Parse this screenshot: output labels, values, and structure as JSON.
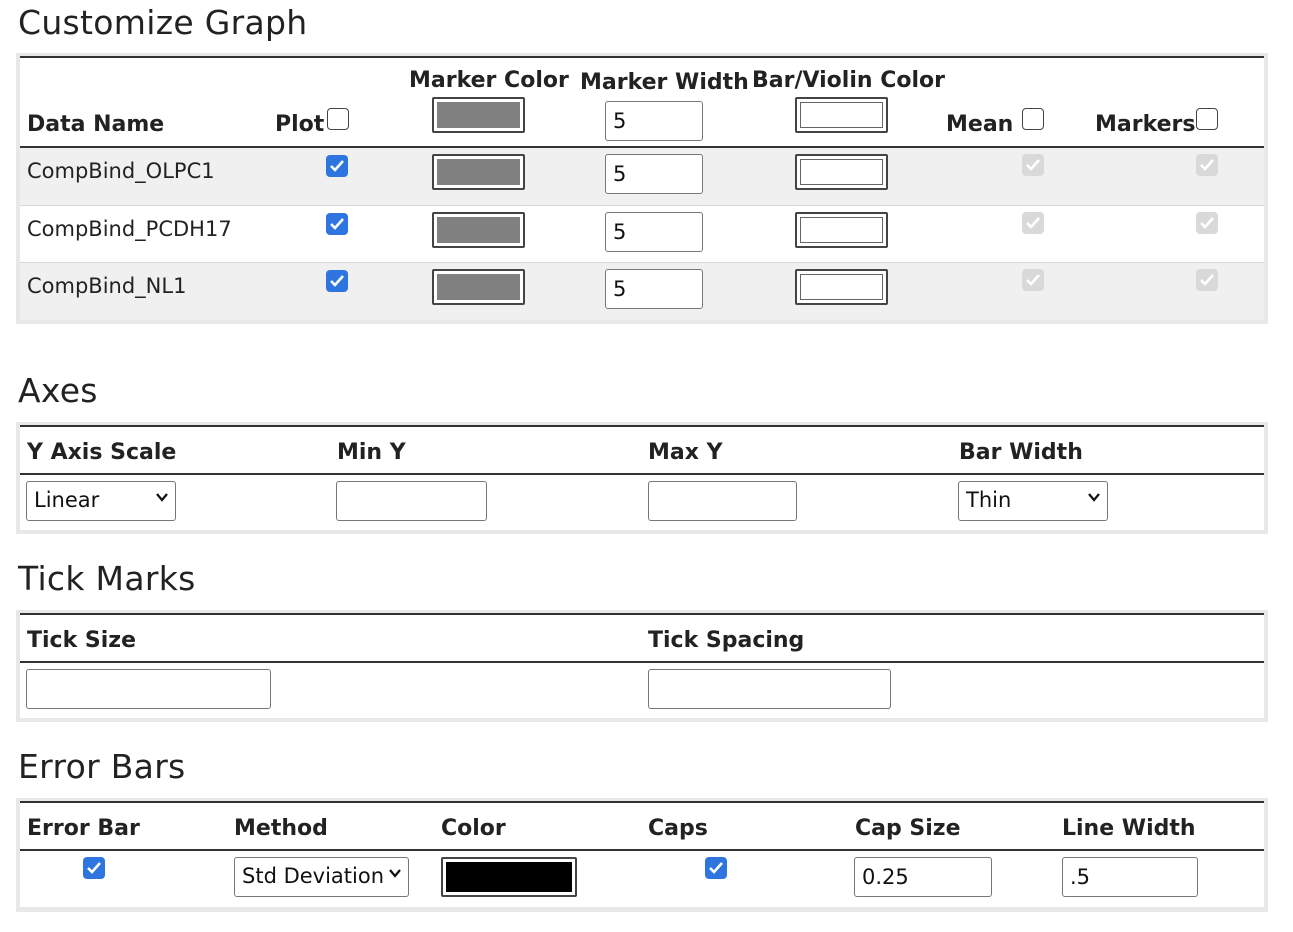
{
  "sections": {
    "customize_title": "Customize Graph",
    "axes_title": "Axes",
    "tick_title": "Tick Marks",
    "error_title": "Error Bars"
  },
  "customize": {
    "headers": {
      "data_name": "Data Name",
      "plot": "Plot",
      "marker_color": "Marker Color",
      "marker_width": "Marker Width",
      "bar_violin_color": "Bar/Violin Color",
      "mean": "Mean",
      "markers": "Markers"
    },
    "header_marker_width_value": "5",
    "rows": [
      {
        "name": "CompBind_OLPC1",
        "width": "5"
      },
      {
        "name": "CompBind_PCDH17",
        "width": "5"
      },
      {
        "name": "CompBind_NL1",
        "width": "5"
      }
    ],
    "marker_color": "#808080",
    "bar_color": "#ffffff"
  },
  "axes": {
    "headers": {
      "y_scale": "Y Axis Scale",
      "min_y": "Min Y",
      "max_y": "Max Y",
      "bar_width": "Bar Width"
    },
    "y_scale_value": "Linear",
    "min_y_value": "",
    "max_y_value": "",
    "bar_width_value": "Thin"
  },
  "ticks": {
    "headers": {
      "tick_size": "Tick Size",
      "tick_spacing": "Tick Spacing"
    },
    "tick_size_value": "",
    "tick_spacing_value": ""
  },
  "error_bars": {
    "headers": {
      "error_bar": "Error Bar",
      "method": "Method",
      "color": "Color",
      "caps": "Caps",
      "cap_size": "Cap Size",
      "line_width": "Line Width"
    },
    "method_value": "Std Deviation",
    "color": "#000000",
    "cap_size_value": "0.25",
    "line_width_value": ".5"
  },
  "colors": {
    "accent_checkbox": "#2f75e0",
    "disabled_checkbox": "#d9d9d9",
    "panel_border": "#e8e8e8"
  }
}
